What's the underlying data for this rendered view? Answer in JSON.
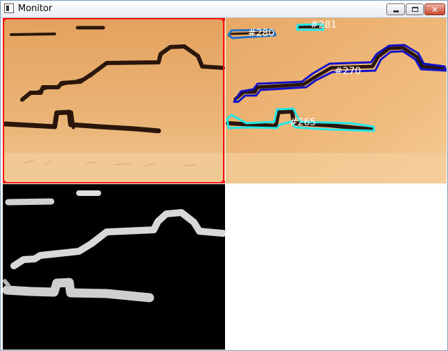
{
  "window": {
    "title": "Monitor",
    "buttons": {
      "minimize": "minimize",
      "maximize": "maximize",
      "close": "close"
    }
  },
  "tracked_objects": [
    {
      "id": "#280",
      "color": "#1e73c8"
    },
    {
      "id": "#281",
      "color": "#22e8e8"
    },
    {
      "id": "#270",
      "color": "#1010c8"
    },
    {
      "id": "#265",
      "color": "#22e8e8"
    }
  ],
  "panels": {
    "top_left": "camera-frame-roi",
    "top_right": "tracking-overlay",
    "bottom_left": "mask-view",
    "bottom_right": "empty"
  },
  "colors": {
    "roi": "#ff1010",
    "paper": "#e9a866",
    "ink": "#2a160a",
    "mask": "#d8d8d8"
  }
}
